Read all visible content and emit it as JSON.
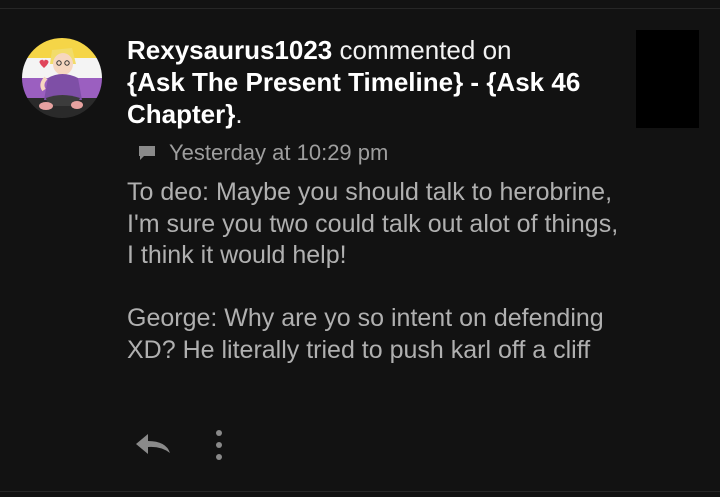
{
  "comment": {
    "username": "Rexysaurus1023",
    "action_text": "commented on",
    "target_title": "{Ask The Present Timeline} - {Ask 46 Chapter}",
    "target_suffix": ".",
    "timestamp": "Yesterday at 10:29 pm",
    "paragraphs": [
      "To deo: Maybe you should talk to herobrine, I'm sure you two could talk out alot of things, I think it would help!",
      "George: Why are yo so intent on defending XD? He literally tried to push karl off a cliff"
    ]
  },
  "icons": {
    "avatar": "user-avatar",
    "timestamp": "comment-icon",
    "reply": "reply-arrow-icon",
    "more": "more-vertical-icon"
  },
  "colors": {
    "background": "#121212",
    "username": "#ffffff",
    "body_text": "#b0b0b0",
    "meta_text": "#9e9e9e",
    "icon": "#8a8a8a",
    "thumbnail": "#000000"
  }
}
